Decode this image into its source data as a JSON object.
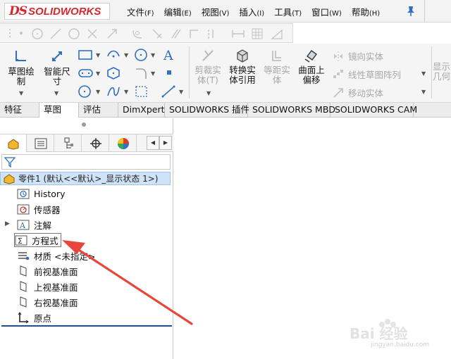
{
  "app": {
    "logo_prefix": "DS",
    "logo_text": "SOLIDWORKS"
  },
  "menu": [
    {
      "label": "文件",
      "accel": "(F)"
    },
    {
      "label": "编辑",
      "accel": "(E)"
    },
    {
      "label": "视图",
      "accel": "(V)"
    },
    {
      "label": "插入",
      "accel": "(I)"
    },
    {
      "label": "工具",
      "accel": "(T)"
    },
    {
      "label": "窗口",
      "accel": "(W)"
    },
    {
      "label": "帮助",
      "accel": "(H)"
    }
  ],
  "ribbon": {
    "sketch_label": "草图绘\n制",
    "smart_dim_label": "智能尺\n寸",
    "trim_label": "剪裁实\n体(T)",
    "convert_label": "转换实\n体引用",
    "offset_label": "等距实\n体",
    "surface_offset_label": "曲面上\n偏移",
    "mirror_label": "镜向实体",
    "linear_pattern_label": "线性草图阵列",
    "move_label": "移动实体",
    "display_label": "显示\n几何"
  },
  "tabs": [
    {
      "label": "特征",
      "active": false
    },
    {
      "label": "草图",
      "active": true
    },
    {
      "label": "评估",
      "active": false
    },
    {
      "label": "DimXpert",
      "active": false
    },
    {
      "label": "SOLIDWORKS 插件",
      "active": false
    },
    {
      "label": "SOLIDWORKS MBD",
      "active": false
    },
    {
      "label": "SOLIDWORKS CAM",
      "active": false
    }
  ],
  "tree": {
    "root": "零件1 (默认<<默认>_显示状态 1>)",
    "items": [
      {
        "label": "History",
        "icon": "history-icon"
      },
      {
        "label": "传感器",
        "icon": "sensor-icon"
      },
      {
        "label": "注解",
        "icon": "annotation-icon"
      },
      {
        "label": "方程式",
        "icon": "equation-icon"
      },
      {
        "label": "材质 <未指定>",
        "icon": "material-icon"
      },
      {
        "label": "前视基准面",
        "icon": "plane-icon"
      },
      {
        "label": "上视基准面",
        "icon": "plane-icon"
      },
      {
        "label": "右视基准面",
        "icon": "plane-icon"
      },
      {
        "label": "原点",
        "icon": "origin-icon"
      }
    ]
  },
  "watermark": {
    "text": "Bai 经验",
    "url": "jingyan.baidu.com"
  },
  "colors": {
    "brand_red": "#d9262b",
    "selection_blue": "#cfe3f7",
    "arrow_red": "#e8453c"
  }
}
